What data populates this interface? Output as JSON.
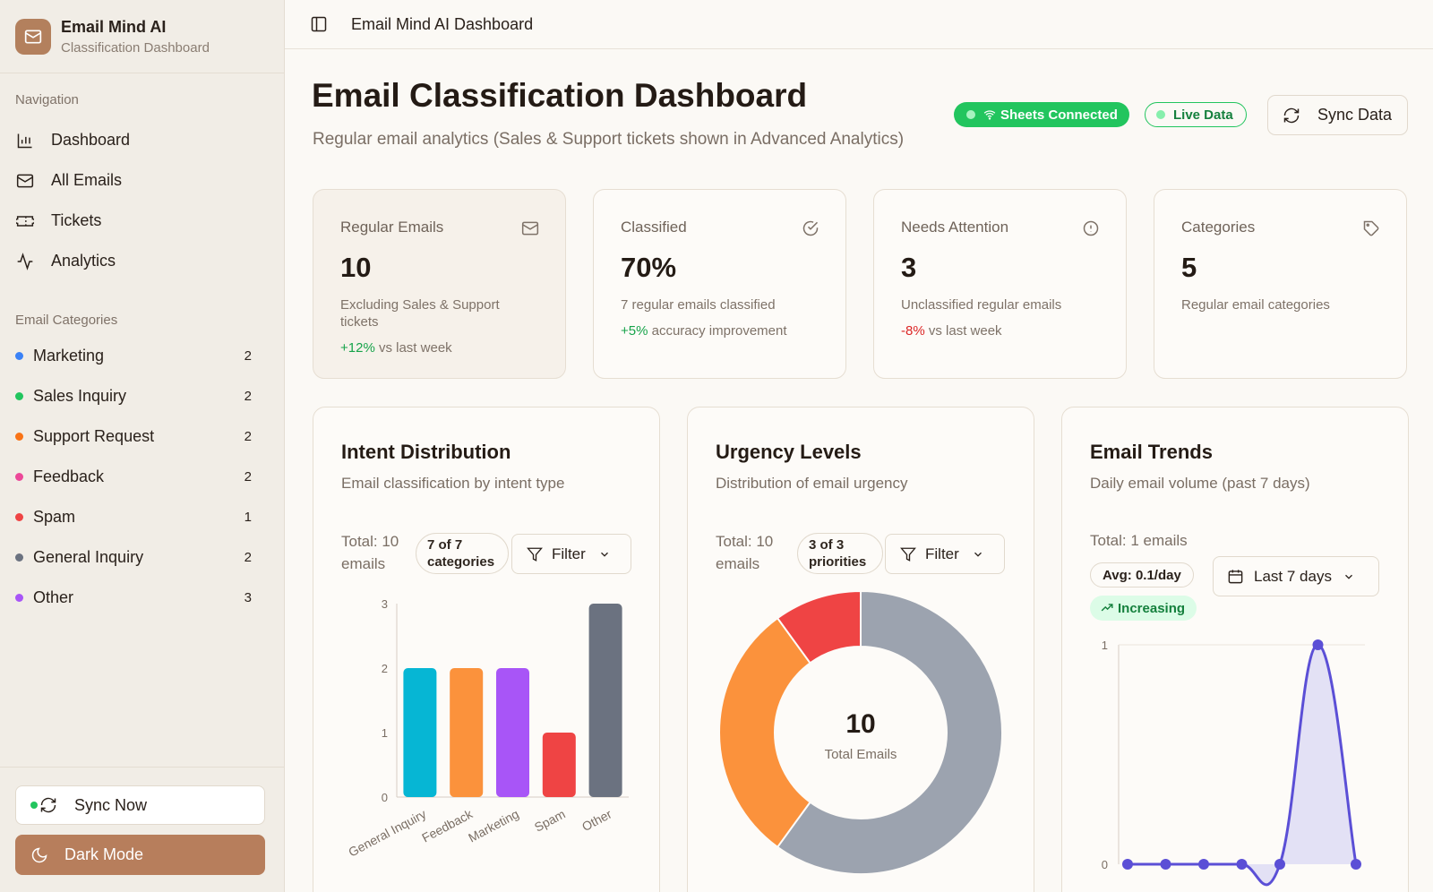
{
  "brand": {
    "title": "Email Mind AI",
    "subtitle": "Classification Dashboard"
  },
  "sidebar": {
    "nav_label": "Navigation",
    "nav": [
      {
        "label": "Dashboard",
        "icon": "bar-chart-icon"
      },
      {
        "label": "All Emails",
        "icon": "mail-icon"
      },
      {
        "label": "Tickets",
        "icon": "ticket-icon"
      },
      {
        "label": "Analytics",
        "icon": "activity-icon"
      }
    ],
    "categories_label": "Email Categories",
    "categories": [
      {
        "name": "Marketing",
        "count": "2",
        "color": "#3b82f6"
      },
      {
        "name": "Sales Inquiry",
        "count": "2",
        "color": "#22c55e"
      },
      {
        "name": "Support Request",
        "count": "2",
        "color": "#f97316"
      },
      {
        "name": "Feedback",
        "count": "2",
        "color": "#ec4899"
      },
      {
        "name": "Spam",
        "count": "1",
        "color": "#ef4444"
      },
      {
        "name": "General Inquiry",
        "count": "2",
        "color": "#6b7280"
      },
      {
        "name": "Other",
        "count": "3",
        "color": "#a855f7"
      }
    ],
    "sync_now": "Sync Now",
    "dark_mode": "Dark Mode"
  },
  "topbar": {
    "title": "Email Mind AI Dashboard"
  },
  "header": {
    "title": "Email Classification Dashboard",
    "subtitle": "Regular email analytics (Sales & Support tickets shown in Advanced Analytics)",
    "sheets_badge": "Sheets Connected",
    "live_badge": "Live Data",
    "sync_button": "Sync Data"
  },
  "stats": [
    {
      "label": "Regular Emails",
      "value": "10",
      "desc": "Excluding Sales & Support tickets",
      "trend_value": "+12%",
      "trend_text": " vs last week",
      "icon": "mail-icon"
    },
    {
      "label": "Classified",
      "value": "70%",
      "desc": "7 regular emails classified",
      "trend_value": "+5%",
      "trend_text": " accuracy improvement",
      "icon": "check-circle-icon"
    },
    {
      "label": "Needs Attention",
      "value": "3",
      "desc": "Unclassified regular emails",
      "trend_value": "-8%",
      "trend_text": " vs last week",
      "icon": "alert-circle-icon"
    },
    {
      "label": "Categories",
      "value": "5",
      "desc": "Regular email categories",
      "icon": "tag-icon"
    }
  ],
  "intent": {
    "title": "Intent Distribution",
    "subtitle": "Email classification by intent type",
    "total": "Total: 10 emails",
    "pill": "7 of 7 categories",
    "filter": "Filter"
  },
  "urgency": {
    "title": "Urgency Levels",
    "subtitle": "Distribution of email urgency",
    "total": "Total: 10 emails",
    "pill": "3 of 3 priorities",
    "filter": "Filter",
    "center_value": "10",
    "center_label": "Total Emails"
  },
  "trends": {
    "title": "Email Trends",
    "subtitle": "Daily email volume (past 7 days)",
    "total": "Total: 1 emails",
    "avg": "Avg: 0.1/day",
    "increasing": "Increasing",
    "range": "Last 7 days"
  },
  "chart_data": [
    {
      "type": "bar",
      "categories": [
        "General Inquiry",
        "Feedback",
        "Marketing",
        "Spam",
        "Other"
      ],
      "values": [
        2,
        2,
        2,
        1,
        3
      ],
      "colors": [
        "#06b6d4",
        "#fb923c",
        "#a855f7",
        "#ef4444",
        "#6b7280"
      ],
      "ylim": [
        0,
        3
      ],
      "yticks": [
        0,
        1,
        2,
        3
      ]
    },
    {
      "type": "pie",
      "donut": true,
      "values": [
        6,
        3,
        1
      ],
      "colors": [
        "#9ca3af",
        "#fb923c",
        "#ef4444"
      ]
    },
    {
      "type": "area",
      "x": [
        1,
        2,
        3,
        4,
        5,
        6,
        7
      ],
      "values": [
        0,
        0,
        0,
        0,
        0,
        1,
        0
      ],
      "ylim": [
        0,
        1
      ],
      "yticks": [
        0,
        1
      ],
      "color": "#5b4fd6"
    }
  ]
}
